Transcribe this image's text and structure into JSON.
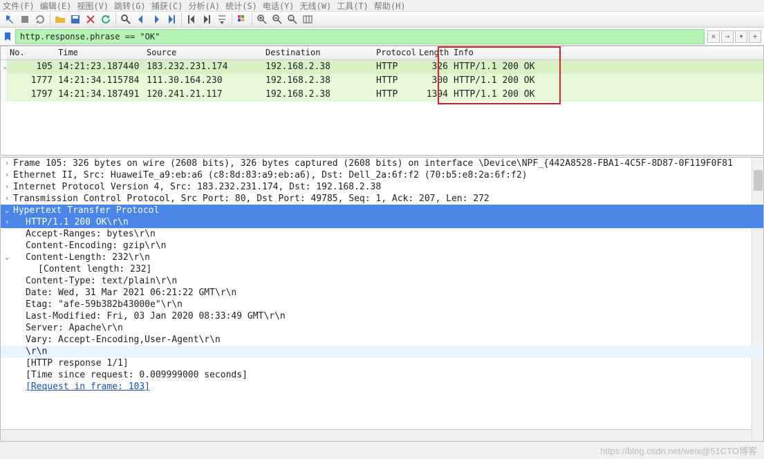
{
  "menu": {
    "items": [
      "文件(F)",
      "编辑(E)",
      "视图(V)",
      "跳转(G)",
      "捕获(C)",
      "分析(A)",
      "统计(S)",
      "电话(Y)",
      "无线(W)",
      "工具(T)",
      "帮助(H)"
    ]
  },
  "filter": {
    "value": "http.response.phrase == \"OK\""
  },
  "columns": {
    "no": "No.",
    "time": "Time",
    "source": "Source",
    "dest": "Destination",
    "proto": "Protocol",
    "len": "Length",
    "info": "Info"
  },
  "rows": [
    {
      "no": "105",
      "time": "14:21:23.187440",
      "src": "183.232.231.174",
      "dst": "192.168.2.38",
      "proto": "HTTP",
      "len": "326",
      "info": "HTTP/1.1 200 OK"
    },
    {
      "no": "1777",
      "time": "14:21:34.115784",
      "src": "111.30.164.230",
      "dst": "192.168.2.38",
      "proto": "HTTP",
      "len": "300",
      "info": "HTTP/1.1 200 OK"
    },
    {
      "no": "1797",
      "time": "14:21:34.187491",
      "src": "120.241.21.117",
      "dst": "192.168.2.38",
      "proto": "HTTP",
      "len": "1394",
      "info": "HTTP/1.1 200 OK"
    }
  ],
  "details": {
    "frame": "Frame 105: 326 bytes on wire (2608 bits), 326 bytes captured (2608 bits) on interface \\Device\\NPF_{442A8528-FBA1-4C5F-8D87-0F119F0F81",
    "eth": "Ethernet II, Src: HuaweiTe_a9:eb:a6 (c8:8d:83:a9:eb:a6), Dst: Dell_2a:6f:f2 (70:b5:e8:2a:6f:f2)",
    "ip": "Internet Protocol Version 4, Src: 183.232.231.174, Dst: 192.168.2.38",
    "tcp": "Transmission Control Protocol, Src Port: 80, Dst Port: 49785, Seq: 1, Ack: 207, Len: 272",
    "http": "Hypertext Transfer Protocol",
    "status": "HTTP/1.1 200 OK\\r\\n",
    "lines": [
      "Accept-Ranges: bytes\\r\\n",
      "Content-Encoding: gzip\\r\\n",
      "Content-Length: 232\\r\\n",
      "[Content length: 232]",
      "Content-Type: text/plain\\r\\n",
      "Date: Wed, 31 Mar 2021 06:21:22 GMT\\r\\n",
      "Etag: \"afe-59b382b43000e\"\\r\\n",
      "Last-Modified: Fri, 03 Jan 2020 08:33:49 GMT\\r\\n",
      "Server: Apache\\r\\n",
      "Vary: Accept-Encoding,User-Agent\\r\\n",
      "\\r\\n",
      "[HTTP response 1/1]",
      "[Time since request: 0.009999000 seconds]"
    ],
    "reqlink": "[Request in frame: 103]"
  },
  "watermark": "https://blog.csdn.net/weix@51CTO博客"
}
